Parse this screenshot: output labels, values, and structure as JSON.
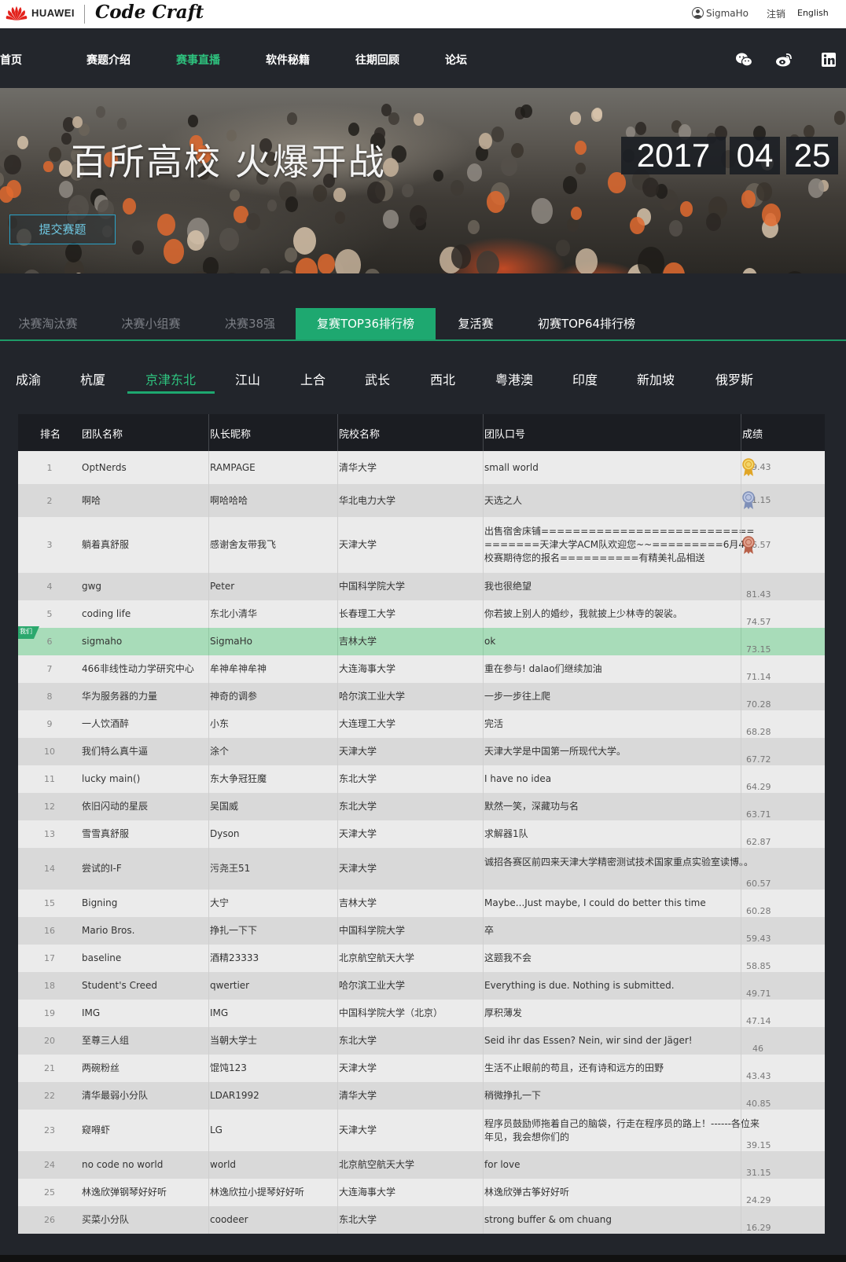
{
  "brand": {
    "huawei": "HUAWEI",
    "product": "Code Craft"
  },
  "user": {
    "name": "SigmaHo",
    "logout": "注销",
    "lang": "English"
  },
  "nav": {
    "items": [
      "首页",
      "赛题介绍",
      "赛事直播",
      "软件秘籍",
      "往期回顾",
      "论坛"
    ],
    "active_index": 2
  },
  "banner": {
    "title": "百所高校 火爆开战",
    "submit": "提交赛题",
    "year": "2017",
    "month": "04",
    "day": "25"
  },
  "round_tabs": [
    "决赛淘汰赛",
    "决赛小组赛",
    "决赛38强",
    "复赛TOP36排行榜",
    "复活赛",
    "初赛TOP64排行榜"
  ],
  "round_active_index": 3,
  "region_tabs": [
    "成渝",
    "杭厦",
    "京津东北",
    "江山",
    "上合",
    "武长",
    "西北",
    "粤港澳",
    "印度",
    "新加坡",
    "俄罗斯"
  ],
  "region_active_index": 2,
  "table": {
    "headers": [
      "排名",
      "团队名称",
      "队长昵称",
      "院校名称",
      "团队口号",
      "成绩"
    ],
    "my_tag": "我们",
    "rows": [
      {
        "rank": "1",
        "team": "OptNerds",
        "captain": "RAMPAGE",
        "school": "清华大学",
        "slogan": "small world",
        "score": "99.43"
      },
      {
        "rank": "2",
        "team": "啊哈",
        "captain": "啊哈哈哈",
        "school": "华北电力大学",
        "slogan": "天选之人",
        "score": "91.15"
      },
      {
        "rank": "3",
        "team": "躺着真舒服",
        "captain": "感谢舍友带我飞",
        "school": "天津大学",
        "slogan": "出售宿舍床铺==================================天津大学ACM队欢迎您~~=========6月4日校赛期待您的报名==========有精美礼品相送",
        "score": "86.57"
      },
      {
        "rank": "4",
        "team": "gwg",
        "captain": "Peter",
        "school": "中国科学院大学",
        "slogan": "我也很绝望",
        "score": "81.43"
      },
      {
        "rank": "5",
        "team": "coding life",
        "captain": "东北小清华",
        "school": "长春理工大学",
        "slogan": "你若披上别人的婚纱，我就披上少林寺的袈裟。",
        "score": "74.57"
      },
      {
        "rank": "6",
        "team": "sigmaho",
        "captain": "SigmaHo",
        "school": "吉林大学",
        "slogan": "ok",
        "score": "73.15"
      },
      {
        "rank": "7",
        "team": "466非线性动力学研究中心",
        "captain": "牟神牟神牟神",
        "school": "大连海事大学",
        "slogan": "重在参与! dalao们继续加油",
        "score": "71.14"
      },
      {
        "rank": "8",
        "team": "华为服务器的力量",
        "captain": "神奇的调参",
        "school": "哈尔滨工业大学",
        "slogan": "一步一步往上爬",
        "score": "70.28"
      },
      {
        "rank": "9",
        "team": "一人饮酒醉",
        "captain": "小东",
        "school": "大连理工大学",
        "slogan": "完活",
        "score": "68.28"
      },
      {
        "rank": "10",
        "team": "我们特么真牛逼",
        "captain": "涂个",
        "school": "天津大学",
        "slogan": "天津大学是中国第一所现代大学。",
        "score": "67.72"
      },
      {
        "rank": "11",
        "team": "lucky main()",
        "captain": "东大争冠狂魔",
        "school": "东北大学",
        "slogan": "I have no idea",
        "score": "64.29"
      },
      {
        "rank": "12",
        "team": "依旧闪动的星辰",
        "captain": "吴国威",
        "school": "东北大学",
        "slogan": "默然一笑，深藏功与名",
        "score": "63.71"
      },
      {
        "rank": "13",
        "team": "雪雪真舒服",
        "captain": "Dyson",
        "school": "天津大学",
        "slogan": "求解器1队",
        "score": "62.87"
      },
      {
        "rank": "14",
        "team": "尝试的I-F",
        "captain": "污尧王51",
        "school": "天津大学",
        "slogan": "诚招各赛区前四来天津大学精密测试技术国家重点实验室读博。。",
        "score": "60.57"
      },
      {
        "rank": "15",
        "team": "Bigning",
        "captain": "大宁",
        "school": "吉林大学",
        "slogan": "Maybe...Just maybe, I could do better this time",
        "score": "60.28"
      },
      {
        "rank": "16",
        "team": "Mario Bros.",
        "captain": "挣扎一下下",
        "school": "中国科学院大学",
        "slogan": "卒",
        "score": "59.43"
      },
      {
        "rank": "17",
        "team": "baseline",
        "captain": "酒精23333",
        "school": "北京航空航天大学",
        "slogan": "这题我不会",
        "score": "58.85"
      },
      {
        "rank": "18",
        "team": "Student's Creed",
        "captain": "qwertier",
        "school": "哈尔滨工业大学",
        "slogan": "Everything is due. Nothing is submitted.",
        "score": "49.71"
      },
      {
        "rank": "19",
        "team": "IMG",
        "captain": "IMG",
        "school": "中国科学院大学（北京）",
        "slogan": "厚积薄发",
        "score": "47.14"
      },
      {
        "rank": "20",
        "team": "至尊三人组",
        "captain": "当朝大学士",
        "school": "东北大学",
        "slogan": "Seid ihr das Essen? Nein, wir sind der Jäger!",
        "score": "46"
      },
      {
        "rank": "21",
        "team": "两碗粉丝",
        "captain": "馄饨123",
        "school": "天津大学",
        "slogan": "生活不止眼前的苟且，还有诗和远方的田野",
        "score": "43.43"
      },
      {
        "rank": "22",
        "team": "清华最弱小分队",
        "captain": "LDAR1992",
        "school": "清华大学",
        "slogan": "稍微挣扎一下",
        "score": "40.85"
      },
      {
        "rank": "23",
        "team": "窥嘚虾",
        "captain": "LG",
        "school": "天津大学",
        "slogan": "程序员鼓励师拖着自己的脑袋，行走在程序员的路上！------各位来年见，我会想你们的",
        "score": "39.15"
      },
      {
        "rank": "24",
        "team": "no code no world",
        "captain": "world",
        "school": "北京航空航天大学",
        "slogan": "for love",
        "score": "31.15"
      },
      {
        "rank": "25",
        "team": "林逸欣弹钢琴好好听",
        "captain": "林逸欣拉小提琴好好听",
        "school": "大连海事大学",
        "slogan": "林逸欣弹古筝好好听",
        "score": "24.29"
      },
      {
        "rank": "26",
        "team": "买菜小分队",
        "captain": "coodeer",
        "school": "东北大学",
        "slogan": "strong buffer & om chuang",
        "score": "16.29"
      }
    ]
  },
  "colors": {
    "accent": "#1ea870",
    "highlight_row": "#a8dcb9",
    "row_a": "#ebebeb",
    "row_b": "#d9d9d9"
  }
}
